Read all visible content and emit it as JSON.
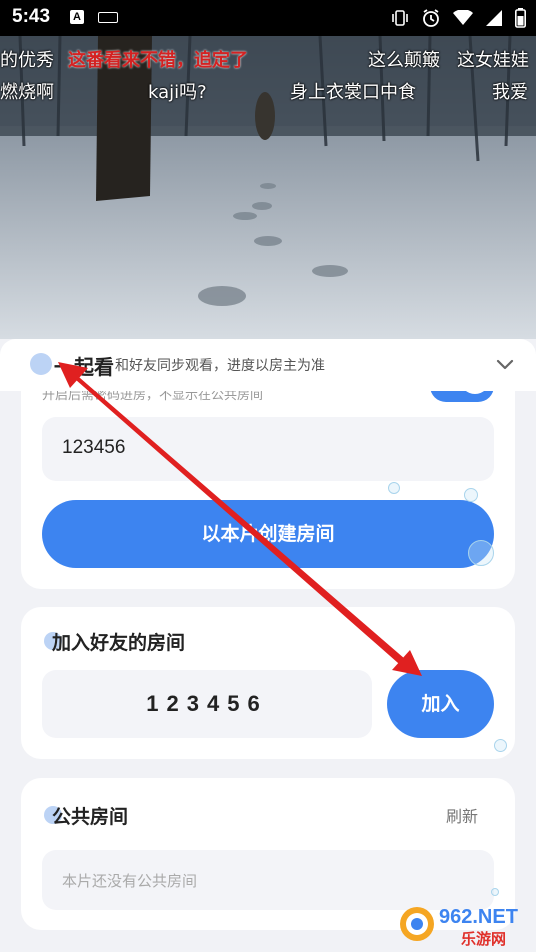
{
  "status_bar": {
    "time": "5:43",
    "icons": [
      "text-notification-icon",
      "keyboard-icon",
      "vibrate-icon",
      "alarm-icon",
      "wifi-icon",
      "signal-icon",
      "battery-icon"
    ]
  },
  "video": {
    "danmaku": [
      {
        "text": "的优秀",
        "style": "white"
      },
      {
        "text": "这番看来不错，追定了",
        "style": "red"
      },
      {
        "text": "这么颠簸",
        "style": "white"
      },
      {
        "text": "这女娃娃",
        "style": "white"
      },
      {
        "text": "燃烧啊",
        "style": "white"
      },
      {
        "text": "kaji吗?",
        "style": "white"
      },
      {
        "text": "身上衣裳口中食",
        "style": "white"
      },
      {
        "text": "我爱",
        "style": "white"
      }
    ]
  },
  "panel": {
    "title": "一起看",
    "subtitle": "和好友同步观看，进度以房主为准"
  },
  "create_room": {
    "hint_partial": "开启后需密码进房，不显示在公共房间",
    "password_value": "123456",
    "create_button": "以本片创建房间"
  },
  "join_room": {
    "title": "加入好友的房间",
    "room_code": "123456",
    "join_button": "加入"
  },
  "public_rooms": {
    "title": "公共房间",
    "refresh": "刷新",
    "empty_text": "本片还没有公共房间"
  },
  "watermark": {
    "domain": "962.NET",
    "site": "乐游网"
  },
  "colors": {
    "accent": "#3d84f0",
    "annotation_arrow": "#e02020",
    "danmaku_red": "#d42222"
  }
}
